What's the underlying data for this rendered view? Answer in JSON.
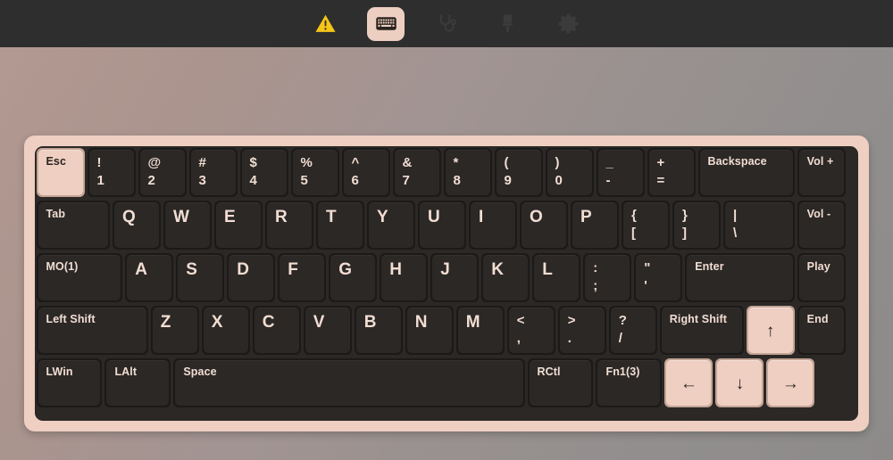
{
  "toolbar": {
    "buttons": [
      {
        "icon": "warning-triangle-icon",
        "name": "warnings-button",
        "active": false,
        "label": "Warnings"
      },
      {
        "icon": "keyboard-icon",
        "name": "keymap-button",
        "active": true,
        "label": "Keymap"
      },
      {
        "icon": "stethoscope-icon",
        "name": "diagnostics-button",
        "active": false,
        "label": "Diagnostics"
      },
      {
        "icon": "paintbrush-icon",
        "name": "appearance-button",
        "active": false,
        "label": "Appearance"
      },
      {
        "icon": "gear-icon",
        "name": "settings-button",
        "active": false,
        "label": "Settings"
      }
    ]
  },
  "colors": {
    "case": "#eecfc2",
    "plate": "#2b2826",
    "key": "#2b2826",
    "key_side": "#1c1a19",
    "key_text": "#f2ddd2",
    "highlight_top": "#eecfc2",
    "highlight_side": "#c3a596",
    "highlight_text": "#2b2420",
    "toolbar_bg": "#2e2e2e",
    "accent": "#f5c518"
  },
  "keyboard": {
    "unit": 57,
    "rows": [
      {
        "name": "number-row",
        "keys": [
          {
            "name": "key-escape",
            "label": "Esc",
            "style": "word",
            "w": 1.0,
            "highlight": true
          },
          {
            "name": "key-1",
            "top": "!",
            "bottom": "1",
            "style": "dual",
            "w": 1.0
          },
          {
            "name": "key-2",
            "top": "@",
            "bottom": "2",
            "style": "dual",
            "w": 1.0
          },
          {
            "name": "key-3",
            "top": "#",
            "bottom": "3",
            "style": "dual",
            "w": 1.0
          },
          {
            "name": "key-4",
            "top": "$",
            "bottom": "4",
            "style": "dual",
            "w": 1.0
          },
          {
            "name": "key-5",
            "top": "%",
            "bottom": "5",
            "style": "dual",
            "w": 1.0
          },
          {
            "name": "key-6",
            "top": "^",
            "bottom": "6",
            "style": "dual",
            "w": 1.0
          },
          {
            "name": "key-7",
            "top": "&",
            "bottom": "7",
            "style": "dual",
            "w": 1.0
          },
          {
            "name": "key-8",
            "top": "*",
            "bottom": "8",
            "style": "dual",
            "w": 1.0
          },
          {
            "name": "key-9",
            "top": "(",
            "bottom": "9",
            "style": "dual",
            "w": 1.0
          },
          {
            "name": "key-0",
            "top": ")",
            "bottom": "0",
            "style": "dual",
            "w": 1.0
          },
          {
            "name": "key-minus",
            "top": "_",
            "bottom": "-",
            "style": "dual",
            "w": 1.0
          },
          {
            "name": "key-equal",
            "top": "+",
            "bottom": "=",
            "style": "dual",
            "w": 1.0
          },
          {
            "name": "key-backspace",
            "label": "Backspace",
            "style": "word",
            "w": 1.95
          },
          {
            "name": "key-volume-up",
            "label": "Vol +",
            "style": "word",
            "w": 1.0
          }
        ]
      },
      {
        "name": "top-letter-row",
        "keys": [
          {
            "name": "key-tab",
            "label": "Tab",
            "style": "word",
            "w": 1.5
          },
          {
            "name": "key-q",
            "label": "Q",
            "style": "single",
            "w": 1.0
          },
          {
            "name": "key-w",
            "label": "W",
            "style": "single",
            "w": 1.0
          },
          {
            "name": "key-e",
            "label": "E",
            "style": "single",
            "w": 1.0
          },
          {
            "name": "key-r",
            "label": "R",
            "style": "single",
            "w": 1.0
          },
          {
            "name": "key-t",
            "label": "T",
            "style": "single",
            "w": 1.0
          },
          {
            "name": "key-y",
            "label": "Y",
            "style": "single",
            "w": 1.0
          },
          {
            "name": "key-u",
            "label": "U",
            "style": "single",
            "w": 1.0
          },
          {
            "name": "key-i",
            "label": "I",
            "style": "single",
            "w": 1.0
          },
          {
            "name": "key-o",
            "label": "O",
            "style": "single",
            "w": 1.0
          },
          {
            "name": "key-p",
            "label": "P",
            "style": "single",
            "w": 1.0
          },
          {
            "name": "key-bracket-left",
            "top": "{",
            "bottom": "[",
            "style": "dual",
            "w": 1.0
          },
          {
            "name": "key-bracket-right",
            "top": "}",
            "bottom": "]",
            "style": "dual",
            "w": 1.0
          },
          {
            "name": "key-backslash",
            "top": "|",
            "bottom": "\\",
            "style": "dual",
            "w": 1.45
          },
          {
            "name": "key-volume-down",
            "label": "Vol -",
            "style": "word",
            "w": 1.0
          }
        ]
      },
      {
        "name": "home-row",
        "keys": [
          {
            "name": "key-mo1",
            "label": "MO(1)",
            "style": "word",
            "w": 1.75
          },
          {
            "name": "key-a",
            "label": "A",
            "style": "single",
            "w": 1.0
          },
          {
            "name": "key-s",
            "label": "S",
            "style": "single",
            "w": 1.0
          },
          {
            "name": "key-d",
            "label": "D",
            "style": "single",
            "w": 1.0
          },
          {
            "name": "key-f",
            "label": "F",
            "style": "single",
            "w": 1.0
          },
          {
            "name": "key-g",
            "label": "G",
            "style": "single",
            "w": 1.0
          },
          {
            "name": "key-h",
            "label": "H",
            "style": "single",
            "w": 1.0
          },
          {
            "name": "key-j",
            "label": "J",
            "style": "single",
            "w": 1.0
          },
          {
            "name": "key-k",
            "label": "K",
            "style": "single",
            "w": 1.0
          },
          {
            "name": "key-l",
            "label": "L",
            "style": "single",
            "w": 1.0
          },
          {
            "name": "key-semicolon",
            "top": ":",
            "bottom": ";",
            "style": "dual",
            "w": 1.0
          },
          {
            "name": "key-quote",
            "top": "\"",
            "bottom": "'",
            "style": "dual",
            "w": 1.0
          },
          {
            "name": "key-enter",
            "label": "Enter",
            "style": "word",
            "w": 2.2
          },
          {
            "name": "key-play",
            "label": "Play",
            "style": "word",
            "w": 1.0
          }
        ]
      },
      {
        "name": "bottom-letter-row",
        "keys": [
          {
            "name": "key-left-shift",
            "label": "Left Shift",
            "style": "word",
            "w": 2.25
          },
          {
            "name": "key-z",
            "label": "Z",
            "style": "single",
            "w": 1.0
          },
          {
            "name": "key-x",
            "label": "X",
            "style": "single",
            "w": 1.0
          },
          {
            "name": "key-c",
            "label": "C",
            "style": "single",
            "w": 1.0
          },
          {
            "name": "key-v",
            "label": "V",
            "style": "single",
            "w": 1.0
          },
          {
            "name": "key-b",
            "label": "B",
            "style": "single",
            "w": 1.0
          },
          {
            "name": "key-n",
            "label": "N",
            "style": "single",
            "w": 1.0
          },
          {
            "name": "key-m",
            "label": "M",
            "style": "single",
            "w": 1.0
          },
          {
            "name": "key-comma",
            "top": "<",
            "bottom": ",",
            "style": "dual",
            "w": 1.0
          },
          {
            "name": "key-period",
            "top": ">",
            "bottom": ".",
            "style": "dual",
            "w": 1.0
          },
          {
            "name": "key-slash",
            "top": "?",
            "bottom": "/",
            "style": "dual",
            "w": 1.0
          },
          {
            "name": "key-right-shift",
            "label": "Right Shift",
            "style": "word",
            "w": 1.7
          },
          {
            "name": "key-arrow-up",
            "label": "↑",
            "style": "arrow",
            "w": 1.0,
            "highlight": true
          },
          {
            "name": "key-end",
            "label": "End",
            "style": "word",
            "w": 1.0
          }
        ]
      },
      {
        "name": "modifier-row",
        "keys": [
          {
            "name": "key-left-win",
            "label": "LWin",
            "style": "word",
            "w": 1.35
          },
          {
            "name": "key-left-alt",
            "label": "LAlt",
            "style": "word",
            "w": 1.35
          },
          {
            "name": "key-space",
            "label": "Space",
            "style": "word",
            "w": 6.95
          },
          {
            "name": "key-right-ctrl",
            "label": "RCtl",
            "style": "word",
            "w": 1.35
          },
          {
            "name": "key-fn1",
            "label": "Fn1(3)",
            "style": "word",
            "w": 1.35
          },
          {
            "name": "key-arrow-left",
            "label": "←",
            "style": "arrow",
            "w": 1.0,
            "highlight": true
          },
          {
            "name": "key-arrow-down",
            "label": "↓",
            "style": "arrow",
            "w": 1.0,
            "highlight": true
          },
          {
            "name": "key-arrow-right",
            "label": "→",
            "style": "arrow",
            "w": 1.0,
            "highlight": true
          }
        ]
      }
    ]
  }
}
